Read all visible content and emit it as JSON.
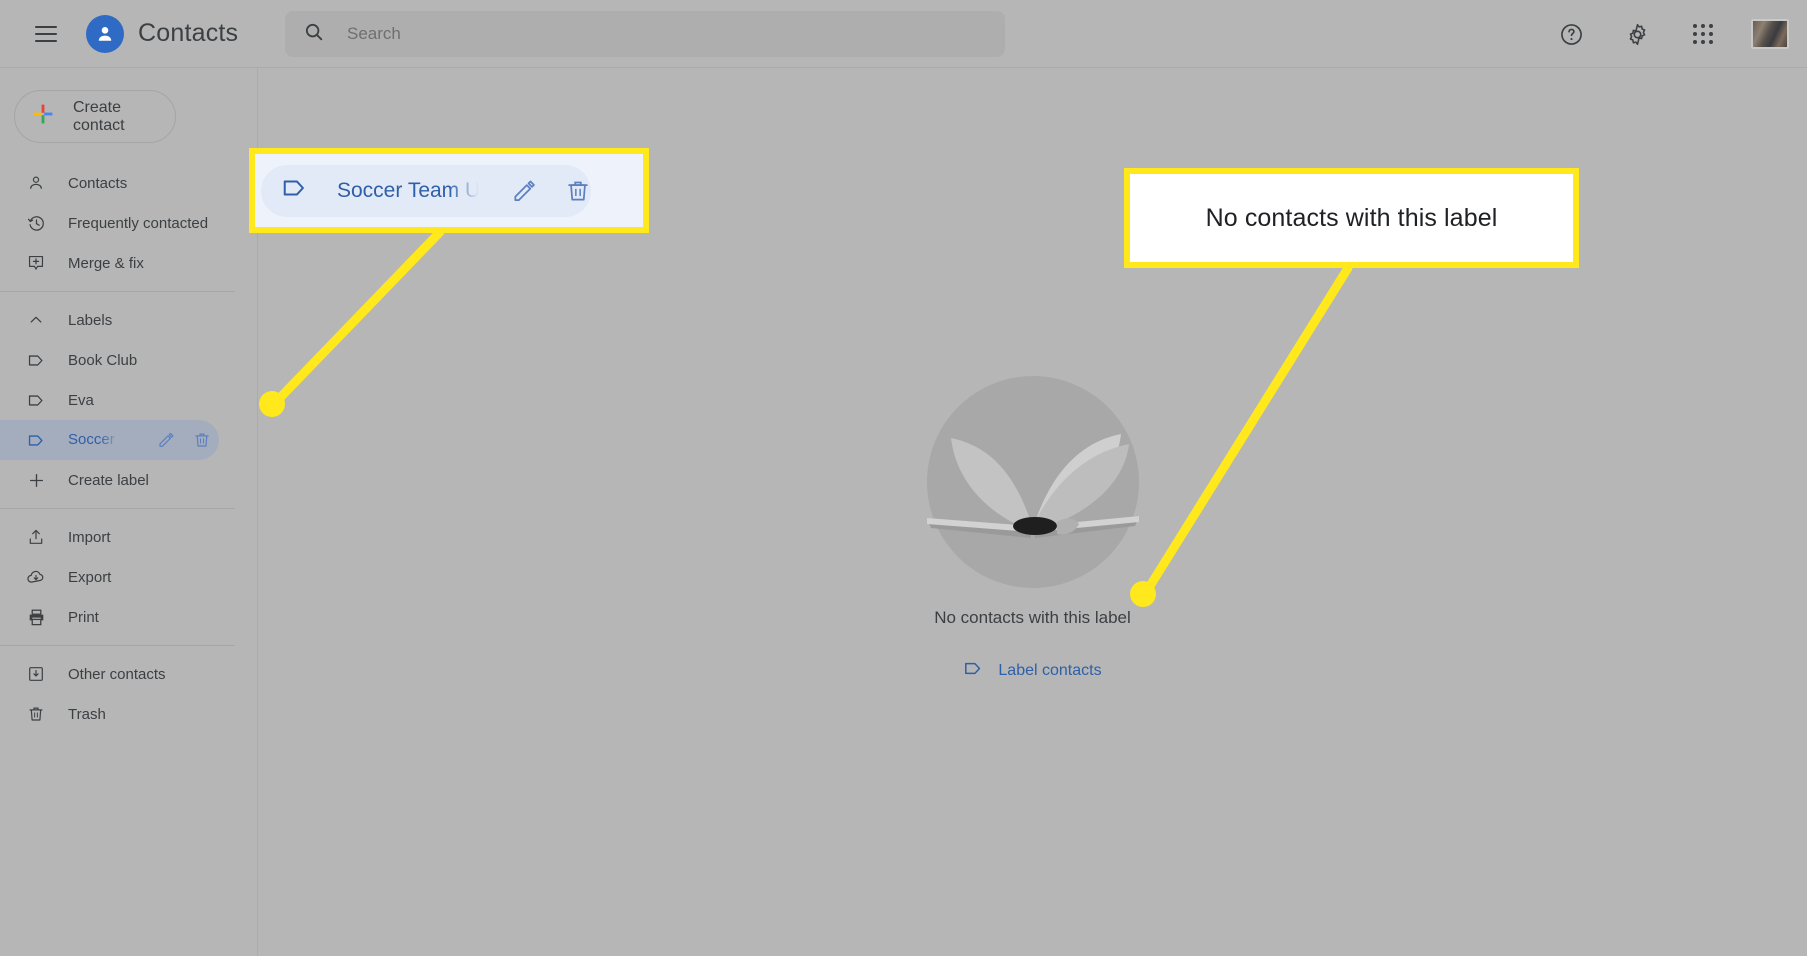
{
  "header": {
    "menu_icon": "hamburger-icon",
    "logo_icon": "contacts-person-icon",
    "title": "Contacts",
    "search": {
      "icon": "search-icon",
      "placeholder": "Search",
      "value": ""
    },
    "actions": [
      {
        "name": "help-icon",
        "label": "Support"
      },
      {
        "name": "gear-icon",
        "label": "Settings"
      },
      {
        "name": "apps-grid-icon",
        "label": "Google apps"
      },
      {
        "name": "avatar",
        "label": "Google Account"
      }
    ]
  },
  "sidebar": {
    "create_contact": {
      "icon": "plus-icon",
      "label": "Create contact"
    },
    "items": [
      {
        "label": "Contacts",
        "icon": "person-icon",
        "selected": false
      },
      {
        "label": "Frequently contacted",
        "icon": "history-clock-icon",
        "selected": false
      },
      {
        "label": "Merge & fix",
        "icon": "merge-icon",
        "selected": false
      }
    ],
    "labels_section": {
      "header": "Labels",
      "collapse_icon": "chevron-up-icon",
      "items": [
        {
          "label": "Book Club",
          "icon": "label-tag-icon",
          "selected": false
        },
        {
          "label": "Eva",
          "icon": "label-tag-icon",
          "selected": false
        },
        {
          "label": "Soccer Team Upd",
          "icon": "label-tag-icon",
          "selected": true,
          "edit_icon": "pencil-icon",
          "delete_icon": "trash-icon"
        }
      ],
      "create_label": {
        "label": "Create label",
        "icon": "plus-icon"
      }
    },
    "tools": [
      {
        "label": "Import",
        "icon": "upload-icon"
      },
      {
        "label": "Export",
        "icon": "download-cloud-icon"
      },
      {
        "label": "Print",
        "icon": "printer-icon"
      }
    ],
    "footer": [
      {
        "label": "Other contacts",
        "icon": "other-contacts-icon"
      },
      {
        "label": "Trash",
        "icon": "trash-icon"
      }
    ]
  },
  "main": {
    "empty_state": {
      "illustration": "open-book-illustration",
      "message": "No contacts with this label",
      "action": {
        "icon": "label-tag-icon",
        "label": "Label contacts"
      }
    }
  },
  "annotations": {
    "label_chip_callout": {
      "chip_icon": "label-tag-icon",
      "chip_label": "Soccer Team Upd",
      "edit_icon": "pencil-icon",
      "delete_icon": "trash-icon"
    },
    "note_callout": {
      "text": "No contacts with this label"
    },
    "highlight_color": "#ffe81c",
    "dot_color": "#ffe81c"
  }
}
